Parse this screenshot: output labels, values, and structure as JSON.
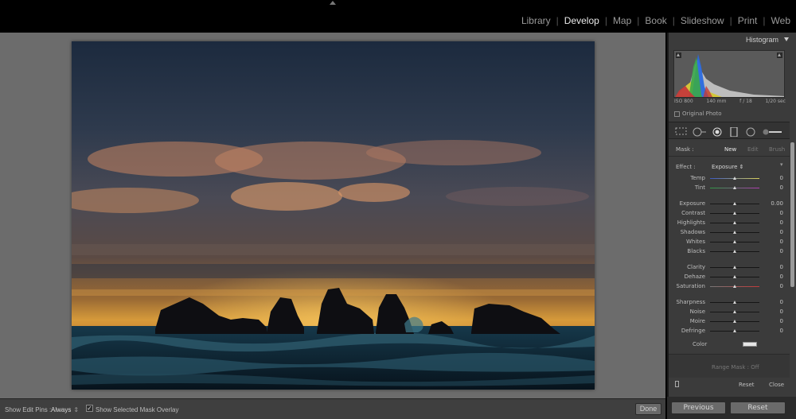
{
  "top_bar": {
    "modules": [
      "Library",
      "Develop",
      "Map",
      "Book",
      "Slideshow",
      "Print",
      "Web"
    ],
    "active_module": "Develop"
  },
  "canvas": {
    "background_color": "#6c6c6c"
  },
  "toolbar": {
    "show_edit_pins_label": "Show Edit Pins :",
    "show_edit_pins_value": "Always",
    "overlay_checked": true,
    "overlay_label": "Show Selected Mask Overlay",
    "done_label": "Done"
  },
  "histogram": {
    "title": "Histogram",
    "iso": "ISO 800",
    "focal": "140 mm",
    "aperture": "f / 18",
    "shutter": "1/20 sec",
    "original_photo_label": "Original Photo"
  },
  "mask": {
    "label": "Mask :",
    "new": "New",
    "edit": "Edit",
    "brush": "Brush"
  },
  "effect": {
    "label": "Effect :",
    "value": "Exposure"
  },
  "sliders": [
    {
      "label": "Temp",
      "value": "0",
      "level": 0.5
    },
    {
      "label": "Tint",
      "value": "0",
      "level": 0.5
    },
    {
      "label": "Exposure",
      "value": "0.00",
      "level": 0.5
    },
    {
      "label": "Contrast",
      "value": "0",
      "level": 0.5
    },
    {
      "label": "Highlights",
      "value": "0",
      "level": 0.5
    },
    {
      "label": "Shadows",
      "value": "0",
      "level": 0.5
    },
    {
      "label": "Whites",
      "value": "0",
      "level": 0.5
    },
    {
      "label": "Blacks",
      "value": "0",
      "level": 0.5
    },
    {
      "label": "Clarity",
      "value": "0",
      "level": 0.5
    },
    {
      "label": "Dehaze",
      "value": "0",
      "level": 0.5
    },
    {
      "label": "Saturation",
      "value": "0",
      "level": 0.5
    },
    {
      "label": "Sharpness",
      "value": "0",
      "level": 0.5
    },
    {
      "label": "Noise",
      "value": "0",
      "level": 0.5
    },
    {
      "label": "Moire",
      "value": "0",
      "level": 0.5
    },
    {
      "label": "Defringe",
      "value": "0",
      "level": 0.5
    }
  ],
  "color_label": "Color",
  "range_mask_label": "Range Mask : Off",
  "panel_bottom": {
    "reset": "Reset",
    "close": "Close"
  },
  "footer_buttons": {
    "previous": "Previous",
    "reset": "Reset"
  }
}
